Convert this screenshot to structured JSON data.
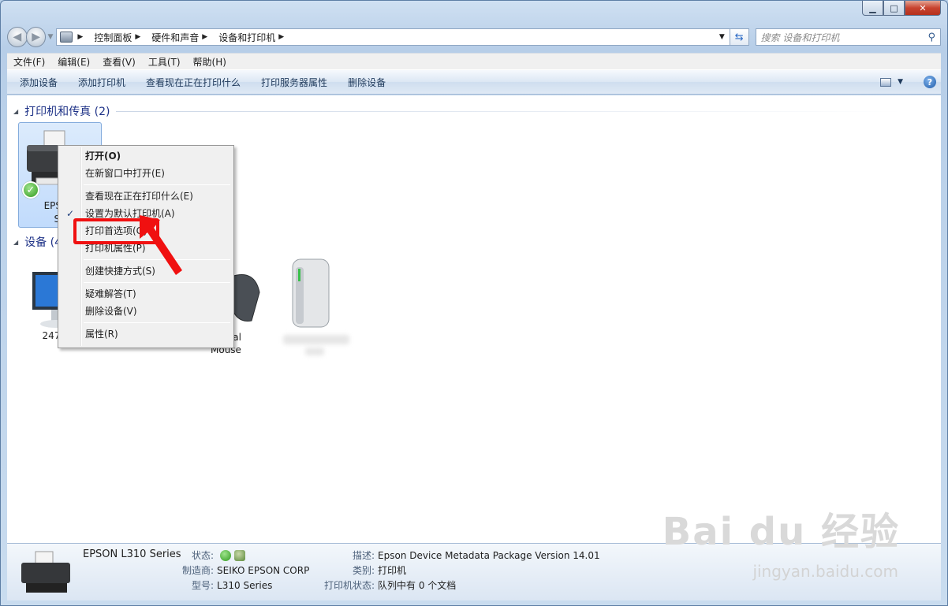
{
  "address": {
    "crumbs": [
      "控制面板",
      "硬件和声音",
      "设备和打印机"
    ],
    "search_placeholder": "搜索 设备和打印机"
  },
  "menubar": [
    "文件(F)",
    "编辑(E)",
    "查看(V)",
    "工具(T)",
    "帮助(H)"
  ],
  "commands": [
    "添加设备",
    "添加打印机",
    "查看现在正在打印什么",
    "打印服务器属性",
    "删除设备"
  ],
  "groups": {
    "printers": "打印机和传真 (2)",
    "devices": "设备 (4"
  },
  "tiles": {
    "epson_label_line1": "EPSON",
    "epson_label_line2": "Se",
    "monitor_label": "247",
    "mouse_label_line1": "ptical",
    "mouse_label_line2": "Mouse"
  },
  "context_menu": {
    "items": [
      {
        "label": "打开(O)",
        "bold": true
      },
      {
        "label": "在新窗口中打开(E)"
      },
      {
        "sep": true
      },
      {
        "label": "查看现在正在打印什么(E)"
      },
      {
        "label": "设置为默认打印机(A)",
        "checked": true
      },
      {
        "label": "打印首选项(G)"
      },
      {
        "label": "打印机属性(P)"
      },
      {
        "sep": true
      },
      {
        "label": "创建快捷方式(S)"
      },
      {
        "sep": true
      },
      {
        "label": "疑难解答(T)"
      },
      {
        "label": "删除设备(V)"
      },
      {
        "sep": true
      },
      {
        "label": "属性(R)"
      }
    ]
  },
  "details": {
    "name": "EPSON L310 Series",
    "status_label": "状态:",
    "manufacturer_label": "制造商:",
    "manufacturer": "SEIKO EPSON CORP",
    "model_label": "型号:",
    "model": "L310 Series",
    "description_label": "描述:",
    "description": "Epson Device Metadata Package Version 14.01",
    "category_label": "类别:",
    "category": "打印机",
    "printer_status_label": "打印机状态:",
    "printer_status": "队列中有 0 个文档"
  },
  "watermark": {
    "brand": "Bai du 经验",
    "url": "jingyan.baidu.com"
  },
  "colors": {
    "accent_red": "#f01010",
    "selection_bg": "#c1dbfc",
    "group_header": "#1e3287"
  }
}
